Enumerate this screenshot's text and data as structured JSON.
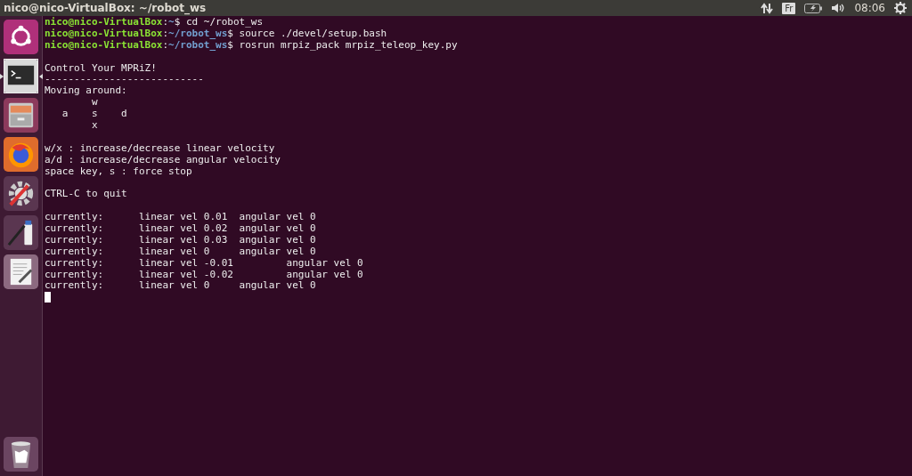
{
  "top_bar": {
    "title": "nico@nico-VirtualBox: ~/robot_ws",
    "keyboard_layout": "Fr",
    "clock": "08:06"
  },
  "launcher": {
    "items": [
      {
        "kind": "ubuntu",
        "selected": false
      },
      {
        "kind": "terminal",
        "selected": true
      },
      {
        "kind": "files",
        "selected": false
      },
      {
        "kind": "browser",
        "selected": false
      },
      {
        "kind": "settings",
        "selected": false
      },
      {
        "kind": "paint",
        "selected": false
      },
      {
        "kind": "editor",
        "selected": false
      }
    ],
    "trash": {
      "kind": "trash"
    }
  },
  "terminal": {
    "lines": [
      {
        "kind": "prompt",
        "user_host": "nico@nico-VirtualBox",
        "separator": ":",
        "path": "~",
        "sign": "$",
        "command": "cd ~/robot_ws"
      },
      {
        "kind": "prompt",
        "user_host": "nico@nico-VirtualBox",
        "separator": ":",
        "path": "~/robot_ws",
        "sign": "$",
        "command": "source ./devel/setup.bash"
      },
      {
        "kind": "prompt",
        "user_host": "nico@nico-VirtualBox",
        "separator": ":",
        "path": "~/robot_ws",
        "sign": "$",
        "command": "rosrun mrpiz_pack mrpiz_teleop_key.py"
      },
      {
        "kind": "blank"
      },
      {
        "kind": "output",
        "text": "Control Your MPRiZ!"
      },
      {
        "kind": "output",
        "text": "---------------------------"
      },
      {
        "kind": "output",
        "text": "Moving around:"
      },
      {
        "kind": "output",
        "text": "        w"
      },
      {
        "kind": "output",
        "text": "   a    s    d"
      },
      {
        "kind": "output",
        "text": "        x"
      },
      {
        "kind": "blank"
      },
      {
        "kind": "output",
        "text": "w/x : increase/decrease linear velocity"
      },
      {
        "kind": "output",
        "text": "a/d : increase/decrease angular velocity"
      },
      {
        "kind": "output",
        "text": "space key, s : force stop"
      },
      {
        "kind": "blank"
      },
      {
        "kind": "output",
        "text": "CTRL-C to quit"
      },
      {
        "kind": "blank"
      },
      {
        "kind": "output",
        "text": "currently:      linear vel 0.01  angular vel 0"
      },
      {
        "kind": "output",
        "text": "currently:      linear vel 0.02  angular vel 0"
      },
      {
        "kind": "output",
        "text": "currently:      linear vel 0.03  angular vel 0"
      },
      {
        "kind": "output",
        "text": "currently:      linear vel 0     angular vel 0"
      },
      {
        "kind": "output",
        "text": "currently:      linear vel -0.01         angular vel 0"
      },
      {
        "kind": "output",
        "text": "currently:      linear vel -0.02         angular vel 0"
      },
      {
        "kind": "output",
        "text": "currently:      linear vel 0     angular vel 0"
      },
      {
        "kind": "cursor"
      }
    ]
  }
}
